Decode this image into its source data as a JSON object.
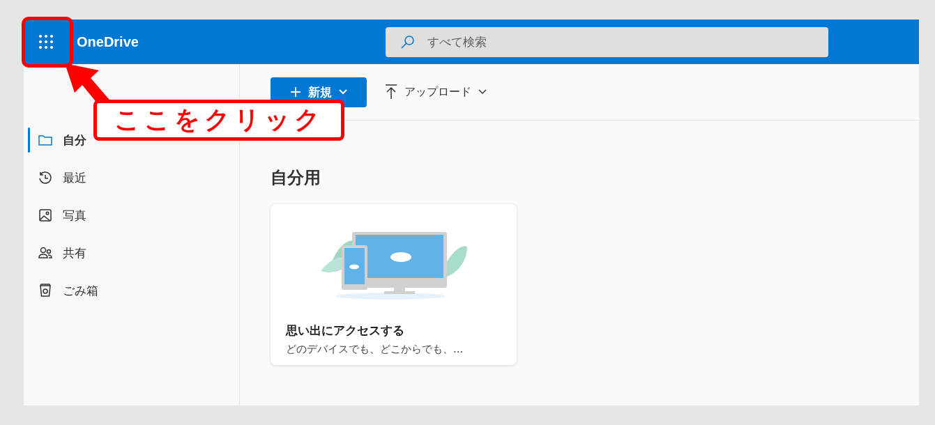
{
  "header": {
    "app_name": "OneDrive",
    "search": {
      "placeholder": "すべて検索"
    }
  },
  "sidebar": {
    "items": [
      {
        "kind": "folder",
        "label": "自分",
        "selected": true
      },
      {
        "kind": "recent",
        "label": "最近",
        "selected": false
      },
      {
        "label": "写真",
        "selected": false
      },
      {
        "kind": "shared",
        "label": "共有",
        "selected": false
      },
      {
        "kind": "trash",
        "label": "ごみ箱",
        "selected": false
      }
    ]
  },
  "toolbar": {
    "new_button": "新規",
    "upload_button": "アップロード"
  },
  "main": {
    "heading": "自分用",
    "card": {
      "kind": "picture",
      "title": "思い出にアクセスする",
      "description": "どのデバイスでも、どこからでも、..."
    }
  },
  "annotation": {
    "callout": "ここをクリック"
  }
}
